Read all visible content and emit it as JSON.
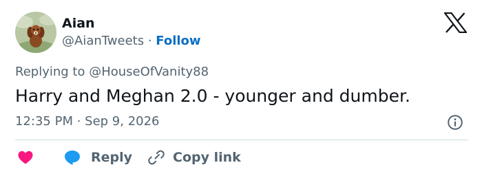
{
  "author": {
    "name": "Aian",
    "handle": "@AianTweets",
    "separator": "·",
    "follow_label": "Follow",
    "avatar_icon": "dog-avatar"
  },
  "platform_icon": "x-logo-icon",
  "replying_to": "Replying to @HouseOfVanity88",
  "tweet_text": "Harry and Meghan 2.0 - younger and dumber.",
  "timestamp": "12:35 PM · Sep 9, 2026",
  "actions": {
    "like_icon": "heart-icon",
    "reply_label": "Reply",
    "reply_icon": "speech-bubble-icon",
    "copy_label": "Copy link",
    "copy_icon": "link-icon"
  },
  "colors": {
    "text": "#0f1419",
    "muted": "#536471",
    "follow": "#0a6fc2",
    "like": "#f91880",
    "reply": "#1d9bf0",
    "divider": "#cfd9de"
  }
}
